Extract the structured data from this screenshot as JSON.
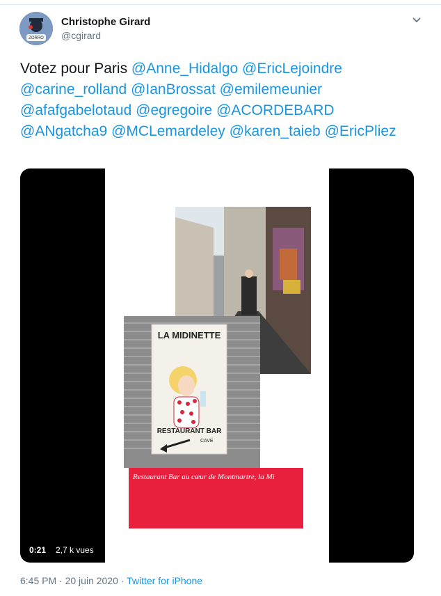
{
  "author": {
    "name": "Christophe Girard",
    "handle": "@cgirard"
  },
  "tweet": {
    "text_prefix": "Votez pour Paris ",
    "mentions": [
      "@Anne_Hidalgo",
      "@EricLejoindre",
      "@carine_rolland",
      "@IanBrossat",
      "@emilemeunier",
      "@afafgabelotaud",
      "@egregoire",
      "@ACORDEBARD",
      "@ANgatcha9",
      "@MCLemardeley",
      "@karen_taieb",
      "@EricPliez"
    ]
  },
  "video": {
    "poster": {
      "title": "LA MIDINETTE",
      "subtitle": "RESTAURANT BAR",
      "cave": "CAVE"
    },
    "caption": "Restaurant Bar au cœur de Montmartre, la Mi",
    "time": "0:21",
    "views": "2,7 k vues"
  },
  "meta": {
    "time": "6:45 PM",
    "separator": "·",
    "date": "20 juin 2020",
    "source": "Twitter for iPhone"
  },
  "colors": {
    "link": "#1b95e0",
    "muted": "#657786",
    "red_card": "#e8203e"
  }
}
